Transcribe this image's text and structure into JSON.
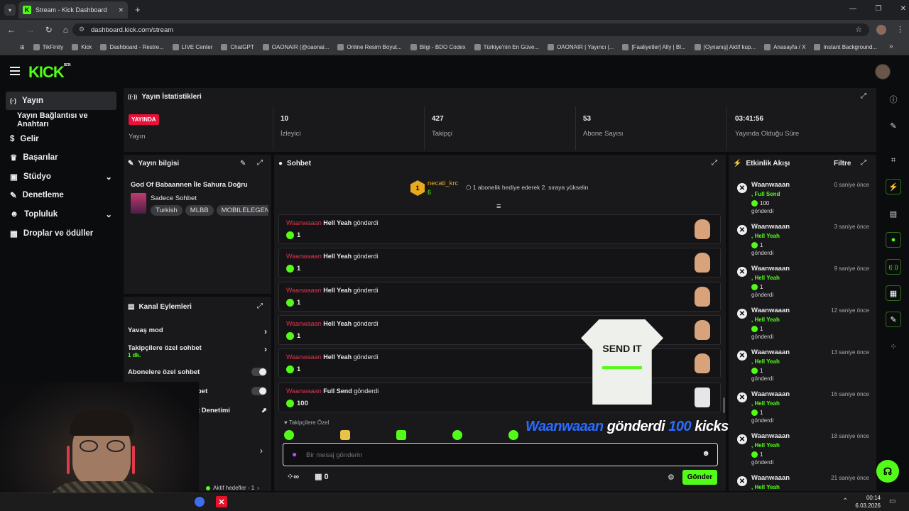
{
  "browser": {
    "tab_title": "Stream - Kick Dashboard",
    "url": "dashboard.kick.com/stream",
    "bookmarks": [
      "TikFinity",
      "Kick",
      "Dashboard - Restre...",
      "LIVE Center",
      "ChatGPT",
      "OAONAIR (@oaonai...",
      "Online Resim Boyut...",
      "Bilgi - BDO Codex",
      "Türkiye'nin En Güve...",
      "OAONAIR | Yayıncı |...",
      "[Faaliyetler] Ally | Bl...",
      "[Oynanış] Aktif kup...",
      "Anasayfa / X",
      "Instant Background..."
    ]
  },
  "brand": {
    "logo": "KICK",
    "badge": "BETA"
  },
  "sidebar": {
    "items": [
      {
        "label": "Yayın",
        "icon": "broadcast-icon"
      },
      {
        "label": "Yayın Bağlantısı ve Anahtarı"
      },
      {
        "label": "Gelir",
        "icon": "dollar-icon"
      },
      {
        "label": "Başarılar",
        "icon": "trophy-icon"
      },
      {
        "label": "Stüdyo",
        "icon": "studio-icon"
      },
      {
        "label": "Denetleme",
        "icon": "wrench-icon"
      },
      {
        "label": "Topluluk",
        "icon": "people-icon"
      },
      {
        "label": "Droplar ve ödüller",
        "icon": "drops-icon"
      }
    ]
  },
  "stats": {
    "title": "Yayın İstatistikleri",
    "live_badge": "YAYINDA",
    "live_label": "Yayın",
    "viewers": "10",
    "viewers_label": "İzleyici",
    "followers": "427",
    "followers_label": "Takipçi",
    "subs": "53",
    "subs_label": "Abone Sayısı",
    "uptime": "03:41:56",
    "uptime_label": "Yayında Olduğu Süre"
  },
  "stream_info": {
    "title": "Yayın bilgisi",
    "stream_title": "God Of Babaannen İle Sahura Doğru",
    "category": "Sadece Sohbet",
    "tags": [
      "Turkish",
      "MLBB",
      "MOBILELEGEN"
    ]
  },
  "channel_actions": {
    "title": "Kanal Eylemleri",
    "slow_mode": "Yavaş mod",
    "followers_only": "Takipçilere özel sohbet",
    "followers_only_sub": "1 dk.",
    "subs_only": "Abonelere özel sohbet",
    "item4": "bet",
    "item5": "t Denetimi",
    "active_goals": "Aktif hedefler - 1"
  },
  "chat": {
    "title": "Sohbet",
    "pinned_user": "necati_krc",
    "pinned_count": "6",
    "pinned_text": "1 abonelik hediye ederek 2. sıraya yükselin",
    "messages": [
      {
        "user": "Waanwaaan",
        "item": "Hell Yeah",
        "verb": "gönderdi",
        "amount": "1"
      },
      {
        "user": "Waanwaaan",
        "item": "Hell Yeah",
        "verb": "gönderdi",
        "amount": "1"
      },
      {
        "user": "Waanwaaan",
        "item": "Hell Yeah",
        "verb": "gönderdi",
        "amount": "1"
      },
      {
        "user": "Waanwaaan",
        "item": "Hell Yeah",
        "verb": "gönderdi",
        "amount": "1"
      },
      {
        "user": "Waanwaaan",
        "item": "Hell Yeah",
        "verb": "gönderdi",
        "amount": "1"
      },
      {
        "user": "Waanwaaan",
        "item": "Full Send",
        "verb": "gönderdi",
        "amount": "100"
      }
    ],
    "followers_only_label": "Takipçilere Özel",
    "overlay_user": "Waanwaaan",
    "overlay_verb": "gönderdi",
    "overlay_amount": "100",
    "overlay_unit": "kicks!",
    "shirt_text": "SEND IT",
    "input_placeholder": "Bir mesaj gönderin",
    "infinity": "∞",
    "gift_count": "0",
    "send_label": "Gönder"
  },
  "activity": {
    "title": "Etkinlik Akışı",
    "filter_label": "Filtre",
    "events": [
      {
        "user": "Waanwaaan",
        "item": "Full Send",
        "amount": "100",
        "verb": "gönderdi",
        "time": "0 saniye önce"
      },
      {
        "user": "Waanwaaan",
        "item": "Hell Yeah",
        "amount": "1",
        "verb": "gönderdi",
        "time": "3 saniye önce"
      },
      {
        "user": "Waanwaaan",
        "item": "Hell Yeah",
        "amount": "1",
        "verb": "gönderdi",
        "time": "9 saniye önce"
      },
      {
        "user": "Waanwaaan",
        "item": "Hell Yeah",
        "amount": "1",
        "verb": "gönderdi",
        "time": "12 saniye önce"
      },
      {
        "user": "Waanwaaan",
        "item": "Hell Yeah",
        "amount": "1",
        "verb": "gönderdi",
        "time": "13 saniye önce"
      },
      {
        "user": "Waanwaaan",
        "item": "Hell Yeah",
        "amount": "1",
        "verb": "gönderdi",
        "time": "16 saniye önce"
      },
      {
        "user": "Waanwaaan",
        "item": "Hell Yeah",
        "amount": "1",
        "verb": "gönderdi",
        "time": "18 saniye önce"
      },
      {
        "user": "Waanwaaan",
        "item": "Hell Yeah",
        "amount": "",
        "verb": "",
        "time": "21 saniye önce"
      }
    ]
  },
  "taskbar": {
    "time": "00:14",
    "date": "6.03.2026"
  },
  "colors": {
    "accent": "#53fc18",
    "live": "#e9113c",
    "username": "#e0324e"
  }
}
